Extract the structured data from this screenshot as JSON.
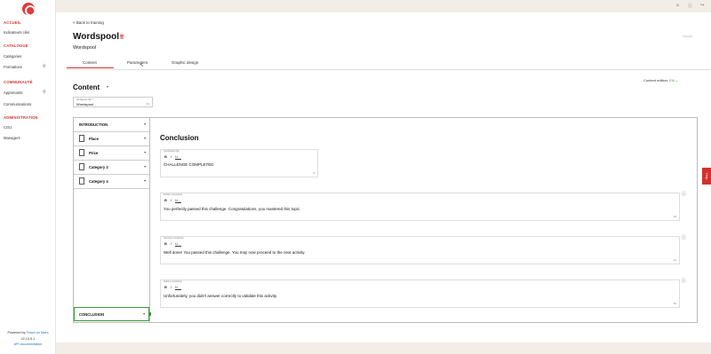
{
  "sidebar": {
    "sections": [
      {
        "title": "ACCUEIL",
        "items": [
          {
            "label": "Indicateurs clés"
          }
        ]
      },
      {
        "title": "CATALOGUE",
        "items": [
          {
            "label": "Catégories"
          },
          {
            "label": "Formations",
            "search": true
          }
        ]
      },
      {
        "title": "COMMUNAUTÉ",
        "items": [
          {
            "label": "Apprenants",
            "search": true
          },
          {
            "label": "Communications"
          }
        ]
      },
      {
        "title": "ADMINISTRATION",
        "items": [
          {
            "label": "CGU"
          },
          {
            "label": "Managers"
          }
        ]
      }
    ],
    "powered_by": "Powered by",
    "powered_link": "Teach on Mars",
    "version": "v2.13.5.1",
    "api_link": "API documentation"
  },
  "topbar": {
    "icons": [
      "user-icon",
      "help-icon",
      "logout-icon"
    ]
  },
  "header": {
    "back_label": "< Back to training",
    "title": "Wordspool",
    "subtitle": "Wordspool",
    "save_label": "Saved"
  },
  "tabs": [
    {
      "label": "Content",
      "active": true
    },
    {
      "label": "Parameters"
    },
    {
      "label": "Graphic design"
    }
  ],
  "content": {
    "heading": "Content",
    "edition_label": "Content edition:",
    "edition_value": "EN",
    "wordspool_title": {
      "label": "Wordspool title *",
      "value": "Wordspool",
      "count": "41"
    }
  },
  "navigation": {
    "items": [
      {
        "label": "INTRODUCTION",
        "icon": false
      },
      {
        "label": "Place",
        "icon": true
      },
      {
        "label": "Price",
        "icon": true
      },
      {
        "label": "Category 3",
        "icon": true
      },
      {
        "label": "Category 4",
        "icon": true
      }
    ],
    "conclusion_item": "CONCLUSION"
  },
  "conclusion": {
    "heading": "Conclusion",
    "fields": [
      {
        "label": "Conclusion title",
        "value": "CHALLENGE COMPLETED",
        "count": "6"
      },
      {
        "label": "Perfect conclusion",
        "value": "You perfectly passed this challenge. Congratulations, you mastered this topic.",
        "count": "22"
      },
      {
        "label": "Success conclusion",
        "value": "Well done! You passed this challenge. You may now proceed to the next activity.",
        "count": "21"
      },
      {
        "label": "Failure conclusion",
        "value": "Unfortunately, you didn't answer correctly to validate this activity.",
        "count": "31"
      }
    ],
    "format_buttons": [
      "B",
      "I",
      "U"
    ]
  },
  "help_tab": "Help",
  "colors": {
    "accent": "#d2322d",
    "active_green": "#3a9a3a",
    "link": "#1b6ec2"
  }
}
